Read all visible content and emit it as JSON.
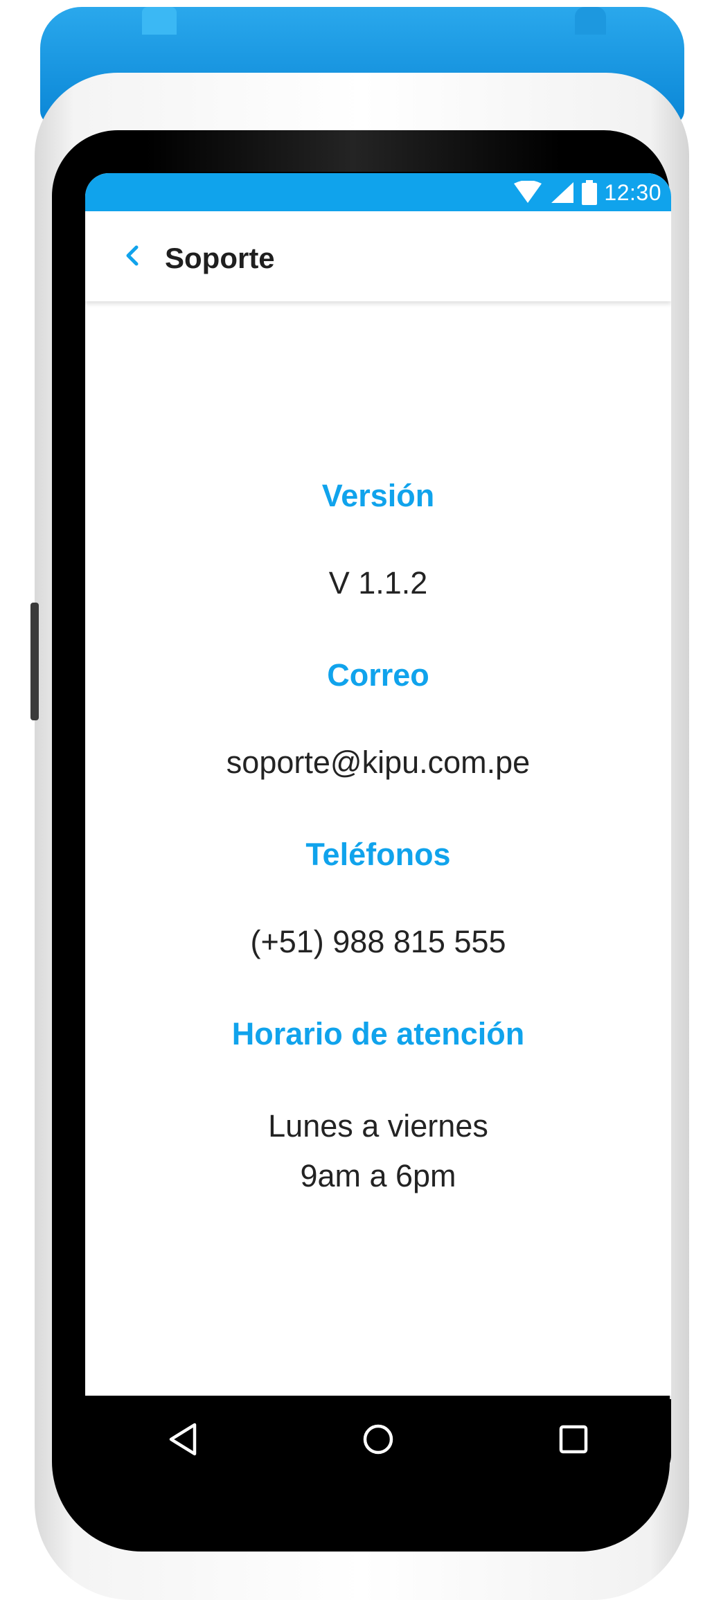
{
  "colors": {
    "accent": "#10a3ec",
    "device_cap": "#0a86d6",
    "text_primary": "#232323",
    "nav_bar": "#000000"
  },
  "status_bar": {
    "time": "12:30",
    "icons": [
      "wifi-icon",
      "signal-icon",
      "battery-icon"
    ]
  },
  "app_bar": {
    "title": "Soporte",
    "back_icon": "chevron-left-icon"
  },
  "support": {
    "version_label": "Versión",
    "version_value": "V 1.1.2",
    "email_label": "Correo",
    "email_value": "soporte@kipu.com.pe",
    "phones_label": "Teléfonos",
    "phones_value": "(+51) 988 815 555",
    "hours_label": "Horario de atención",
    "hours_line1": "Lunes a viernes",
    "hours_line2": "9am a 6pm"
  },
  "nav_bar": {
    "icons": [
      "back-triangle-icon",
      "home-circle-icon",
      "recents-square-icon"
    ]
  }
}
